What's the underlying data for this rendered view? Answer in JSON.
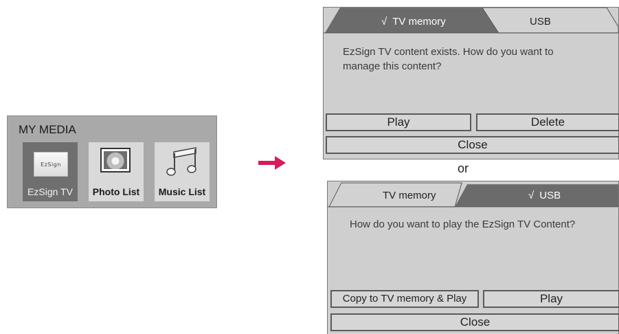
{
  "my_media": {
    "title": "MY MEDIA",
    "items": [
      {
        "label": "EzSign TV",
        "icon": "ezsign-icon",
        "logo_text": "EzSign",
        "selected": true
      },
      {
        "label": "Photo List",
        "icon": "photo-icon",
        "selected": false
      },
      {
        "label": "Music List",
        "icon": "music-note-icon",
        "selected": false
      }
    ]
  },
  "arrow": {
    "icon": "right-arrow-icon",
    "color": "#d81b5a"
  },
  "dialog_tv_memory": {
    "tabs": [
      {
        "label": "TV memory",
        "active": true,
        "check": "√"
      },
      {
        "label": "USB",
        "active": false
      }
    ],
    "message": "EzSign TV content exists. How do you want to manage this content?",
    "buttons": {
      "play": "Play",
      "delete": "Delete",
      "close": "Close"
    }
  },
  "or_text": "or",
  "dialog_usb": {
    "tabs": [
      {
        "label": "TV memory",
        "active": false
      },
      {
        "label": "USB",
        "active": true,
        "check": "√"
      }
    ],
    "message": "How do you want to play the EzSign TV Content?",
    "buttons": {
      "copy_play": "Copy to TV memory & Play",
      "play": "Play",
      "close": "Close"
    }
  },
  "colors": {
    "panel": "#a9a9a9",
    "dialog": "#cfcfcf",
    "active_tab": "#6b6b6b",
    "arrow": "#d81b5a"
  }
}
